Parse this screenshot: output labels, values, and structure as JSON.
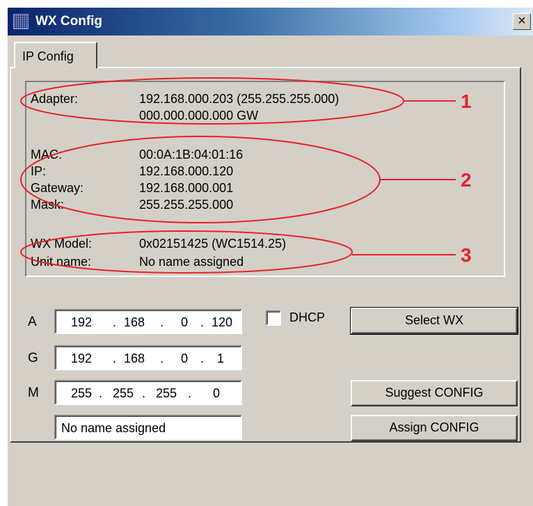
{
  "window": {
    "title": "WX Config",
    "close_symbol": "×"
  },
  "tabs": [
    {
      "label": "IP Config"
    }
  ],
  "info": {
    "adapter": {
      "label": "Adapter:",
      "line1": "192.168.000.203  (255.255.255.000)",
      "line2": "000.000.000.000  GW"
    },
    "mac": {
      "label": "MAC:",
      "value": "00:0A:1B:04:01:16"
    },
    "ip": {
      "label": "IP:",
      "value": "192.168.000.120"
    },
    "gateway": {
      "label": "Gateway:",
      "value": "192.168.000.001"
    },
    "mask": {
      "label": "Mask:",
      "value": "255.255.255.000"
    },
    "model": {
      "label": "WX Model:",
      "value": "0x02151425  (WC1514.25)"
    },
    "unit_name": {
      "label": "Unit name:",
      "value": "No name assigned"
    }
  },
  "fields": {
    "address": {
      "letter": "A",
      "octets": [
        "192",
        "168",
        "0",
        "120"
      ]
    },
    "gateway": {
      "letter": "G",
      "octets": [
        "192",
        "168",
        "0",
        "1"
      ]
    },
    "mask": {
      "letter": "M",
      "octets": [
        "255",
        "255",
        "255",
        "0"
      ]
    },
    "dot": ".",
    "name_value": "No name assigned"
  },
  "dhcp": {
    "label": "DHCP",
    "checked": false
  },
  "buttons": {
    "select": "Select WX",
    "suggest": "Suggest CONFIG",
    "assign": "Assign CONFIG"
  },
  "annotations": {
    "color": "#e8202a",
    "labels": [
      "1",
      "2",
      "3"
    ]
  },
  "colors": {
    "face": "#d4d0c8",
    "title_start": "#0a246a",
    "title_end": "#a6caf0"
  }
}
